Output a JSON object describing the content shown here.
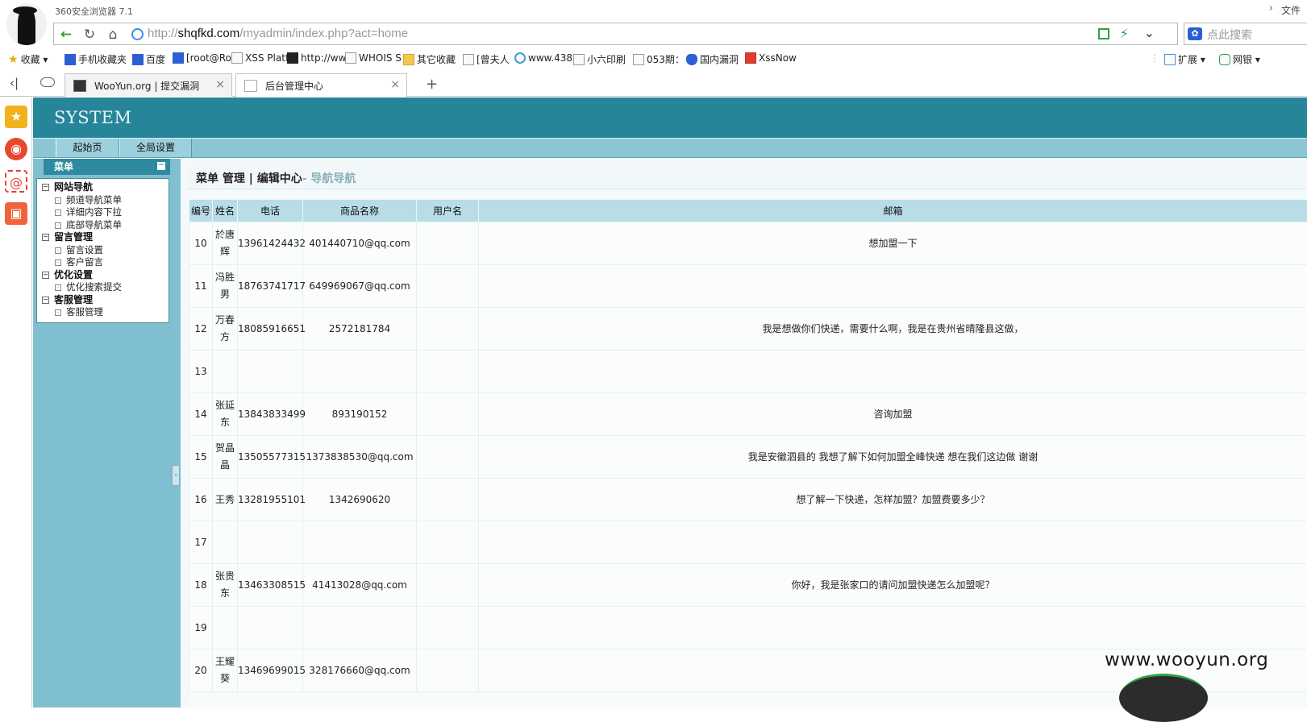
{
  "browser": {
    "app_title": "360安全浏览器 7.1",
    "file_menu": "文件",
    "url_domain": "shqfkd.com",
    "url_prefix": "http://",
    "url_path": "/myadmin/index.php?act=home",
    "search_placeholder": "点此搜索",
    "bookmarks": [
      {
        "label": "收藏",
        "icon": "star-icon"
      },
      {
        "label": "手机收藏夹",
        "icon": "phone-icon"
      },
      {
        "label": "百度",
        "icon": "paw-icon"
      },
      {
        "label": "[root@Ro",
        "icon": "paw-icon"
      },
      {
        "label": "XSS Platf",
        "icon": "page-icon"
      },
      {
        "label": "http://ww",
        "icon": "dark-page-icon"
      },
      {
        "label": "WHOIS S",
        "icon": "w-icon"
      },
      {
        "label": "其它收藏",
        "icon": "folder-icon"
      },
      {
        "label": "[曾夫人",
        "icon": "page-icon"
      },
      {
        "label": "www.438",
        "icon": "search-q-icon"
      },
      {
        "label": "小六印刷",
        "icon": "page-icon"
      },
      {
        "label": "053期：",
        "icon": "page-icon"
      },
      {
        "label": "国内漏洞",
        "icon": "shield-icon"
      },
      {
        "label": "XssNow",
        "icon": "xss-icon"
      }
    ],
    "ext_label": "扩展",
    "netbank_label": "网银",
    "tabs": [
      {
        "title": "WooYun.org | 提交漏洞",
        "active": false
      },
      {
        "title": "后台管理中心",
        "active": true
      }
    ],
    "new_tab": "+"
  },
  "page": {
    "system_title": "SYSTEM",
    "topnav": [
      "起始页",
      "全局设置"
    ],
    "menu_title": "菜单",
    "menu": [
      {
        "group": "网站导航",
        "items": [
          "频道导航菜单",
          "详细内容下拉",
          "底部导航菜单"
        ]
      },
      {
        "group": "留言管理",
        "items": [
          "留言设置",
          "客户留言"
        ]
      },
      {
        "group": "优化设置",
        "items": [
          "优化搜索提交"
        ]
      },
      {
        "group": "客服管理",
        "items": [
          "客服管理"
        ]
      }
    ],
    "content_title": "菜单 管理 | 编辑中心",
    "content_subtitle": "- 导航导航",
    "table": {
      "headers": [
        "编号",
        "姓名",
        "电话",
        "商品名称",
        "用户名",
        "邮箱"
      ],
      "rows": [
        [
          "10",
          "於唐辉",
          "13961424432",
          "401440710@qq.com",
          "",
          "想加盟一下"
        ],
        [
          "11",
          "冯胜男",
          "18763741717",
          "649969067@qq.com",
          "",
          ""
        ],
        [
          "12",
          "万春方",
          "18085916651",
          "2572181784",
          "",
          "我是想做你们快递，需要什么啊，我是在贵州省晴隆县这做，"
        ],
        [
          "13",
          "",
          "",
          "",
          "",
          ""
        ],
        [
          "14",
          "张延东",
          "13843833499",
          "893190152",
          "",
          "咨询加盟"
        ],
        [
          "15",
          "贺晶晶",
          "13505577315",
          "1373838530@qq.com",
          "",
          "我是安徽泗县的 我想了解下如何加盟全峰快递 想在我们这边做 谢谢"
        ],
        [
          "16",
          "王秀",
          "13281955101",
          "1342690620",
          "",
          "想了解一下快递，怎样加盟？加盟费要多少？"
        ],
        [
          "17",
          "",
          "",
          "",
          "",
          ""
        ],
        [
          "18",
          "张贵东",
          "13463308515",
          "41413028@qq.com",
          "",
          "你好，我是张家口的请问加盟快递怎么加盟呢？"
        ],
        [
          "19",
          "",
          "",
          "",
          "",
          ""
        ],
        [
          "20",
          "王耀葵",
          "13469699015",
          "328176660@qq.com",
          "",
          ""
        ]
      ]
    }
  },
  "watermark": "www.wooyun.org"
}
